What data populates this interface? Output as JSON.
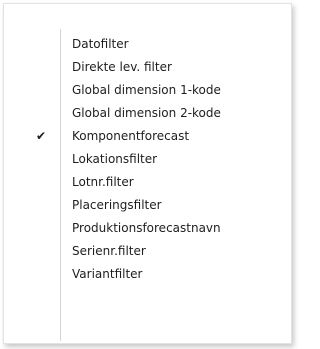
{
  "menu": {
    "items": [
      {
        "label": "Datofilter",
        "checked": false
      },
      {
        "label": "Direkte lev. filter",
        "checked": false
      },
      {
        "label": "Global dimension 1-kode",
        "checked": false
      },
      {
        "label": "Global dimension 2-kode",
        "checked": false
      },
      {
        "label": "Komponentforecast",
        "checked": true
      },
      {
        "label": "Lokationsfilter",
        "checked": false
      },
      {
        "label": "Lotnr.filter",
        "checked": false
      },
      {
        "label": "Placeringsfilter",
        "checked": false
      },
      {
        "label": "Produktionsforecastnavn",
        "checked": false
      },
      {
        "label": "Serienr.filter",
        "checked": false
      },
      {
        "label": "Variantfilter",
        "checked": false
      }
    ],
    "check_glyph": "✔"
  }
}
